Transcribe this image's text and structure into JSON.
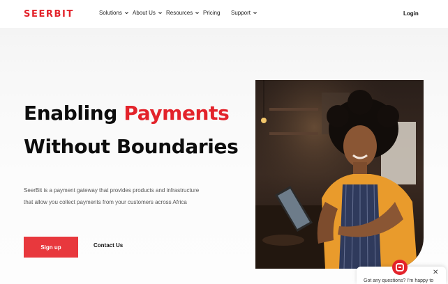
{
  "brand": {
    "name": "SEERBIT",
    "accent_color": "#e3232b"
  },
  "nav": {
    "items": [
      {
        "label": "Solutions",
        "has_dropdown": true
      },
      {
        "label": "About Us",
        "has_dropdown": true
      },
      {
        "label": "Resources",
        "has_dropdown": true
      },
      {
        "label": "Pricing",
        "has_dropdown": false
      },
      {
        "label": "Support",
        "has_dropdown": true
      }
    ],
    "login_label": "Login"
  },
  "hero": {
    "headline_part1": "Enabling ",
    "headline_highlight": "Payments",
    "headline_line2": "Without Boundaries",
    "description": "SeerBit is a payment gateway that provides products and infrastructure that allow you collect payments from your customers across Africa",
    "signup_label": "Sign up",
    "contact_label": "Contact Us",
    "signup_color": "#e8383d"
  },
  "chat": {
    "message": "Got any questions? I'm happy to",
    "close_icon": "close-icon",
    "avatar_icon": "chat-logo-icon"
  }
}
